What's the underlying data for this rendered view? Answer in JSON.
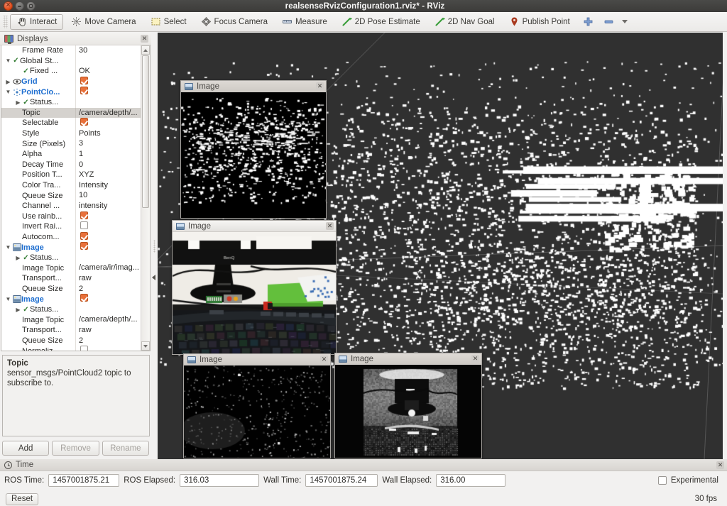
{
  "window": {
    "title": "realsenseRvizConfiguration1.rviz* - RViz",
    "close_glyph": "",
    "minimize_glyph": "",
    "maximize_glyph": ""
  },
  "toolbar": {
    "items": [
      {
        "label": "Interact",
        "icon": "hand-cursor-icon",
        "active": true
      },
      {
        "label": "Move Camera",
        "icon": "move-camera-icon",
        "active": false
      },
      {
        "label": "Select",
        "icon": "selection-box-icon",
        "active": false
      },
      {
        "label": "Focus Camera",
        "icon": "focus-camera-icon",
        "active": false
      },
      {
        "label": "Measure",
        "icon": "measure-icon",
        "active": false
      },
      {
        "label": "2D Pose Estimate",
        "icon": "pose-arrow-icon",
        "active": false
      },
      {
        "label": "2D Nav Goal",
        "icon": "nav-goal-arrow-icon",
        "active": false
      },
      {
        "label": "Publish Point",
        "icon": "map-pin-icon",
        "active": false
      }
    ],
    "add_tool_icon": "plus-icon",
    "remove_tool_icon": "minus-icon",
    "overflow_icon": "chevron-down-icon"
  },
  "displays_panel": {
    "title": "Displays",
    "icon": "displays-monitor-icon",
    "close_glyph": "✕",
    "rows": [
      {
        "indent": 1,
        "expander": "",
        "check": "",
        "icon": "",
        "label": "Frame Rate",
        "link": false,
        "value": "30",
        "value_type": "text",
        "selected": false
      },
      {
        "indent": 0,
        "expander": "▼",
        "check": "✓",
        "icon": "",
        "label": "Global St...",
        "link": false,
        "value": "",
        "value_type": "none",
        "selected": false
      },
      {
        "indent": 1,
        "expander": "",
        "check": "✓",
        "icon": "",
        "label": "Fixed ...",
        "link": false,
        "value": "OK",
        "value_type": "text",
        "selected": false
      },
      {
        "indent": 0,
        "expander": "▶",
        "check": "",
        "icon": "eye-icon",
        "label": "Grid",
        "link": true,
        "value": "checked",
        "value_type": "checkbox",
        "selected": false
      },
      {
        "indent": 0,
        "expander": "▼",
        "check": "",
        "icon": "pointcloud-icon",
        "label": "PointClo...",
        "link": true,
        "value": "checked",
        "value_type": "checkbox",
        "selected": false
      },
      {
        "indent": 1,
        "expander": "▶",
        "check": "✓",
        "icon": "",
        "label": "Status...",
        "link": false,
        "value": "",
        "value_type": "none",
        "selected": false
      },
      {
        "indent": 1,
        "expander": "",
        "check": "",
        "icon": "",
        "label": "Topic",
        "link": false,
        "value": "/camera/depth/...",
        "value_type": "text",
        "selected": true
      },
      {
        "indent": 1,
        "expander": "",
        "check": "",
        "icon": "",
        "label": "Selectable",
        "link": false,
        "value": "checked",
        "value_type": "checkbox",
        "selected": false
      },
      {
        "indent": 1,
        "expander": "",
        "check": "",
        "icon": "",
        "label": "Style",
        "link": false,
        "value": "Points",
        "value_type": "text",
        "selected": false
      },
      {
        "indent": 1,
        "expander": "",
        "check": "",
        "icon": "",
        "label": "Size (Pixels)",
        "link": false,
        "value": "3",
        "value_type": "text",
        "selected": false
      },
      {
        "indent": 1,
        "expander": "",
        "check": "",
        "icon": "",
        "label": "Alpha",
        "link": false,
        "value": "1",
        "value_type": "text",
        "selected": false
      },
      {
        "indent": 1,
        "expander": "",
        "check": "",
        "icon": "",
        "label": "Decay Time",
        "link": false,
        "value": "0",
        "value_type": "text",
        "selected": false
      },
      {
        "indent": 1,
        "expander": "",
        "check": "",
        "icon": "",
        "label": "Position T...",
        "link": false,
        "value": "XYZ",
        "value_type": "text",
        "selected": false
      },
      {
        "indent": 1,
        "expander": "",
        "check": "",
        "icon": "",
        "label": "Color Tra...",
        "link": false,
        "value": "Intensity",
        "value_type": "text",
        "selected": false
      },
      {
        "indent": 1,
        "expander": "",
        "check": "",
        "icon": "",
        "label": "Queue Size",
        "link": false,
        "value": "10",
        "value_type": "text",
        "selected": false
      },
      {
        "indent": 1,
        "expander": "",
        "check": "",
        "icon": "",
        "label": "Channel ...",
        "link": false,
        "value": "intensity",
        "value_type": "text",
        "selected": false
      },
      {
        "indent": 1,
        "expander": "",
        "check": "",
        "icon": "",
        "label": "Use rainb...",
        "link": false,
        "value": "checked",
        "value_type": "checkbox",
        "selected": false
      },
      {
        "indent": 1,
        "expander": "",
        "check": "",
        "icon": "",
        "label": "Invert Rai...",
        "link": false,
        "value": "unchecked",
        "value_type": "checkbox",
        "selected": false
      },
      {
        "indent": 1,
        "expander": "",
        "check": "",
        "icon": "",
        "label": "Autocom...",
        "link": false,
        "value": "checked",
        "value_type": "checkbox",
        "selected": false
      },
      {
        "indent": 0,
        "expander": "▼",
        "check": "",
        "icon": "image-icon",
        "label": "Image",
        "link": true,
        "value": "checked",
        "value_type": "checkbox",
        "selected": false
      },
      {
        "indent": 1,
        "expander": "▶",
        "check": "✓",
        "icon": "",
        "label": "Status...",
        "link": false,
        "value": "",
        "value_type": "none",
        "selected": false
      },
      {
        "indent": 1,
        "expander": "",
        "check": "",
        "icon": "",
        "label": "Image Topic",
        "link": false,
        "value": "/camera/ir/imag...",
        "value_type": "text",
        "selected": false
      },
      {
        "indent": 1,
        "expander": "",
        "check": "",
        "icon": "",
        "label": "Transport...",
        "link": false,
        "value": "raw",
        "value_type": "text",
        "selected": false
      },
      {
        "indent": 1,
        "expander": "",
        "check": "",
        "icon": "",
        "label": "Queue Size",
        "link": false,
        "value": "2",
        "value_type": "text",
        "selected": false
      },
      {
        "indent": 0,
        "expander": "▼",
        "check": "",
        "icon": "image-icon",
        "label": "Image",
        "link": true,
        "value": "checked",
        "value_type": "checkbox",
        "selected": false
      },
      {
        "indent": 1,
        "expander": "▶",
        "check": "✓",
        "icon": "",
        "label": "Status...",
        "link": false,
        "value": "",
        "value_type": "none",
        "selected": false
      },
      {
        "indent": 1,
        "expander": "",
        "check": "",
        "icon": "",
        "label": "Image Topic",
        "link": false,
        "value": "/camera/depth/...",
        "value_type": "text",
        "selected": false
      },
      {
        "indent": 1,
        "expander": "",
        "check": "",
        "icon": "",
        "label": "Transport...",
        "link": false,
        "value": "raw",
        "value_type": "text",
        "selected": false
      },
      {
        "indent": 1,
        "expander": "",
        "check": "",
        "icon": "",
        "label": "Queue Size",
        "link": false,
        "value": "2",
        "value_type": "text",
        "selected": false
      },
      {
        "indent": 1,
        "expander": "",
        "check": "",
        "icon": "",
        "label": "Normaliz...",
        "link": false,
        "value": "unchecked",
        "value_type": "checkbox",
        "selected": false
      }
    ],
    "description": {
      "title": "Topic",
      "body": "sensor_msgs/PointCloud2 topic to subscribe to."
    },
    "buttons": [
      {
        "label": "Add",
        "disabled": false
      },
      {
        "label": "Remove",
        "disabled": true
      },
      {
        "label": "Rename",
        "disabled": true
      }
    ]
  },
  "image_windows": [
    {
      "title": "Image",
      "close_glyph": "✕",
      "variant": "depth-sparse",
      "active": false
    },
    {
      "title": "Image",
      "close_glyph": "✕",
      "variant": "rgb-desk",
      "active": true
    },
    {
      "title": "Image",
      "close_glyph": "✕",
      "variant": "dark-noise",
      "active": false
    },
    {
      "title": "Image",
      "close_glyph": "✕",
      "variant": "ir-desk",
      "active": false
    }
  ],
  "time_panel": {
    "title": "Time",
    "icon": "clock-icon",
    "close_glyph": "✕",
    "fields": [
      {
        "label": "ROS Time:",
        "value": "1457001875.21"
      },
      {
        "label": "ROS Elapsed:",
        "value": "316.03"
      },
      {
        "label": "Wall Time:",
        "value": "1457001875.24"
      },
      {
        "label": "Wall Elapsed:",
        "value": "316.00"
      }
    ],
    "experimental_label": "Experimental",
    "experimental_checked": false
  },
  "status_bar": {
    "reset_label": "Reset",
    "fps": "30 fps"
  },
  "colors": {
    "accent_orange": "#e8703a",
    "link_blue": "#1f6fd0",
    "viewport_bg": "#303030",
    "titlebar_bg": "#3c3b39"
  }
}
